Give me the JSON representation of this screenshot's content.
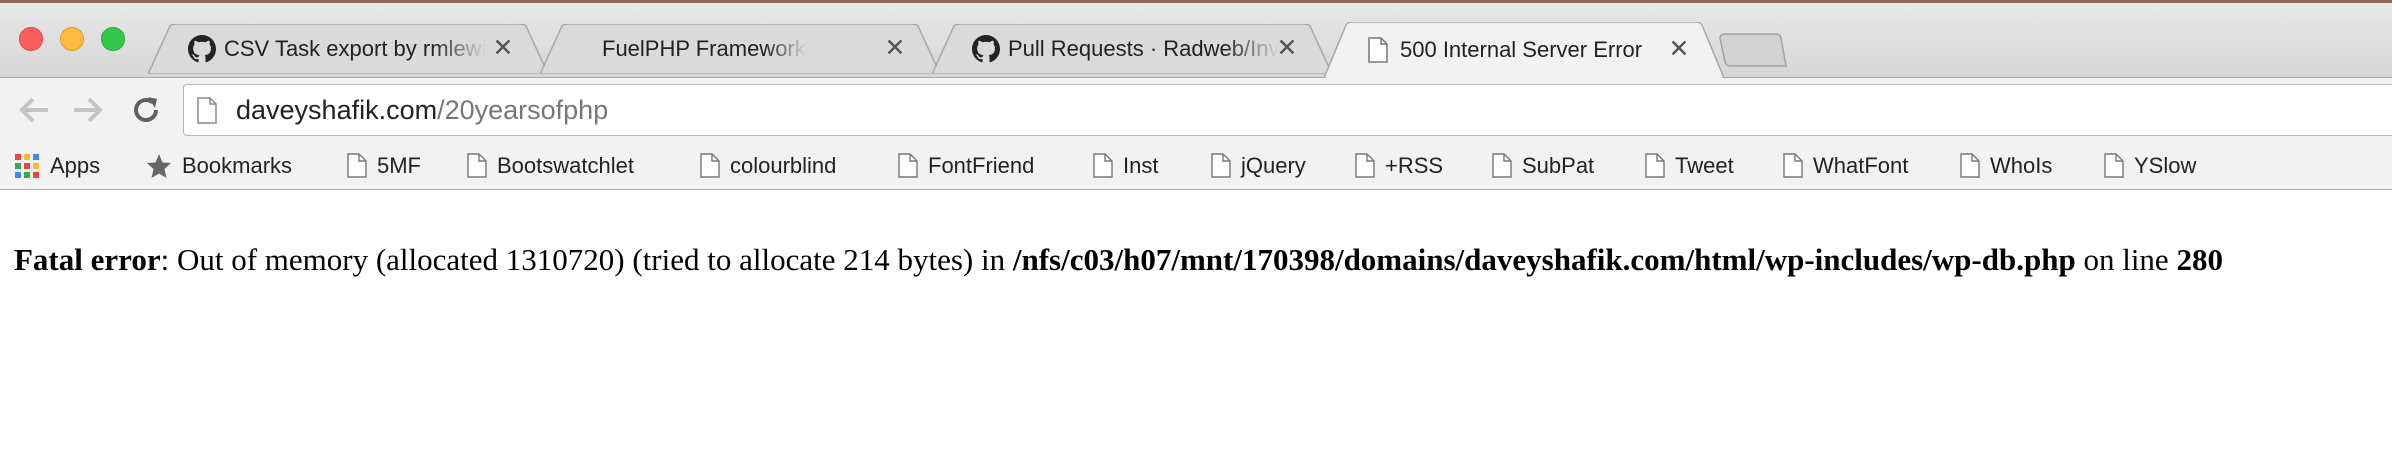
{
  "tabs": [
    {
      "title": "CSV Task export by rmlewi",
      "icon": "github-icon"
    },
    {
      "title": "FuelPHP Framework",
      "icon": ""
    },
    {
      "title": "Pull Requests · Radweb/Inv",
      "icon": "github-icon"
    },
    {
      "title": "500 Internal Server Error",
      "icon": "page-icon",
      "active": true
    }
  ],
  "tab_close_glyph": "✕",
  "address": {
    "domain": "daveyshafik.com",
    "path": "/20yearsofphp"
  },
  "bookmarks": {
    "apps": "Apps",
    "bookmarks": "Bookmarks",
    "items": [
      "5MF",
      "Bootswatchlet",
      "colourblind",
      "FontFriend",
      "Inst",
      "jQuery",
      "+RSS",
      "SubPat",
      "Tweet",
      "WhatFont",
      "WhoIs",
      "YSlow"
    ]
  },
  "error": {
    "label": "Fatal error",
    "message": ": Out of memory (allocated 1310720) (tried to allocate 214 bytes) in ",
    "file": "/nfs/c03/h07/mnt/170398/domains/daveyshafik.com/html/wp-includes/wp-db.php",
    "on_line": " on line ",
    "line": "280"
  },
  "colors": {
    "traffic_red": "#fc605c",
    "traffic_yellow": "#fdbc40",
    "traffic_green": "#34c84a"
  }
}
